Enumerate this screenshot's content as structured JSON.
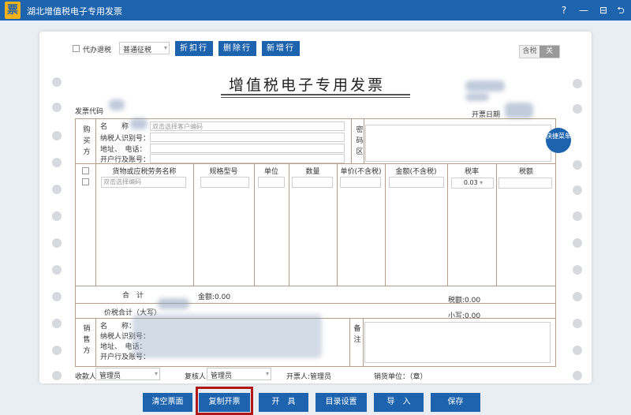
{
  "app": {
    "logo": "票",
    "title": "湖北增值税电子专用发票"
  },
  "window_controls": {
    "help": "?",
    "minimize": "—",
    "maximize": "⊟",
    "back": "⮌"
  },
  "toolbar": {
    "agent_refund_label": "代办退税",
    "tax_type_value": "普通征税",
    "discount_button": "折扣行",
    "delete_button": "删除行",
    "add_button": "新增行"
  },
  "tax_toggle": {
    "on_label": "含税",
    "off_label": "关"
  },
  "invoice": {
    "title": "增值税电子专用发票",
    "code_label": "发票代码",
    "date_label": "开票日期",
    "buyer": {
      "section_label": "购买方",
      "name_label": "名　　称",
      "name_placeholder": "双击选择客户编码",
      "tax_id_label": "纳税人识别号：",
      "address_label": "地址、　电话：",
      "bank_label": "开户行及账号："
    },
    "cipher_label": "密码区",
    "quick_menu": "快捷菜单",
    "columns": {
      "item_name": "货物或应税劳务名称",
      "spec": "规格型号",
      "unit": "单位",
      "qty": "数量",
      "price": "单价(不含税)",
      "amount": "金额(不含税)",
      "rate": "税率",
      "tax": "税额"
    },
    "row": {
      "item_placeholder": "双击选择编码",
      "rate_value": "0.03"
    },
    "total_label": "合　计",
    "amount_total": "金额:0.00",
    "tax_total": "税额:0.00",
    "price_tax_label": "价税合计（大写）",
    "small_label": "小写:0.00",
    "seller": {
      "section_label": "销售方",
      "name_label": "名　　称：",
      "tax_id_label": "纳税人识别号：",
      "address_label": "地址、　电话：",
      "bank_label": "开户行及账号："
    },
    "remark_label": "备注",
    "payee_label": "收款人:",
    "payee_value": "管理员",
    "reviewer_label": "复核人:",
    "reviewer_value": "管理员",
    "drawer_label": "开票人:管理员",
    "seller_seal_label": "销货单位：（章）"
  },
  "bottom_buttons": {
    "clear": "清空票面",
    "copy_issue": "复制开票",
    "issue": "开　具",
    "catalog": "目录设置",
    "import": "导　入",
    "save": "保存"
  },
  "colors": {
    "primary": "#1d63ae",
    "highlight": "#b01818",
    "frame": "#b39f87"
  }
}
